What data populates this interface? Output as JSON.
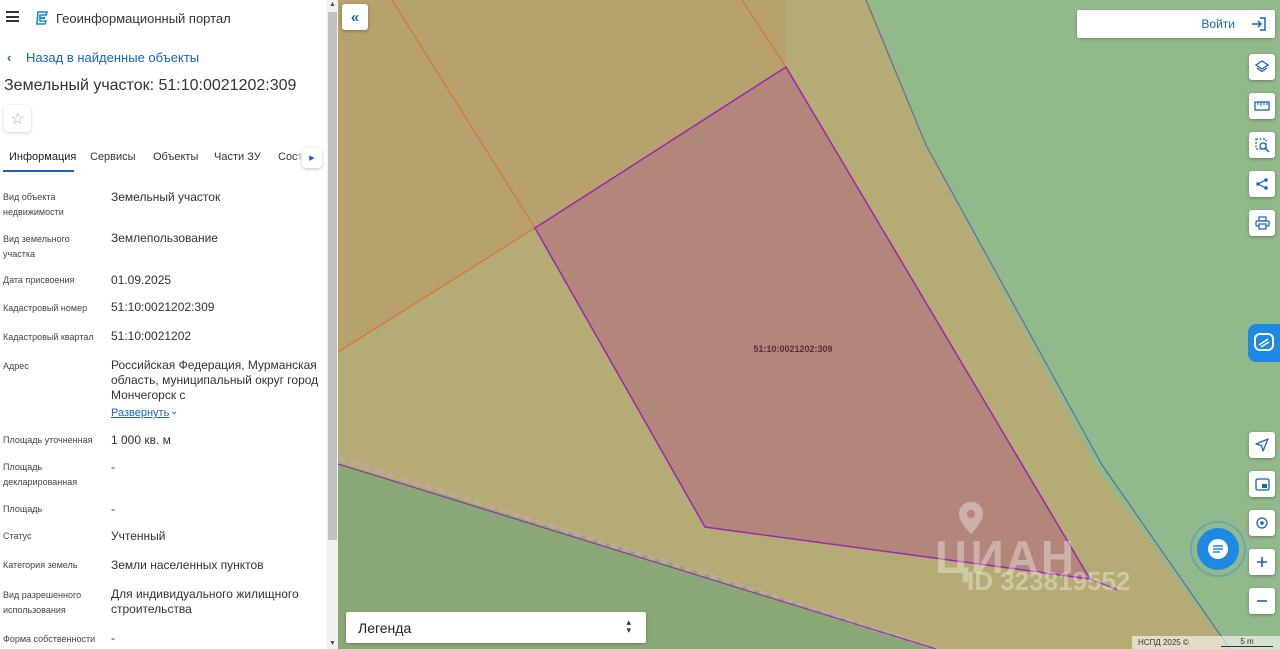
{
  "header": {
    "app_title": "Геоинформационный портал",
    "menu_icon": "hamburger-menu-icon",
    "logo_icon": "portal-logo-icon"
  },
  "back_link": "Назад в найденные объекты",
  "object_title": "Земельный участок: 51:10:0021202:309",
  "tabs": [
    {
      "label": "Информация",
      "active": true
    },
    {
      "label": "Сервисы"
    },
    {
      "label": "Объекты"
    },
    {
      "label": "Части ЗУ"
    },
    {
      "label": "Соста"
    }
  ],
  "properties": [
    {
      "label": "Вид объекта недвижимости",
      "value": "Земельный участок"
    },
    {
      "label": "Вид земельного участка",
      "value": "Землепользование"
    },
    {
      "label": "Дата присвоения",
      "value": "01.09.2025"
    },
    {
      "label": "Кадастровый номер",
      "value": "51:10:0021202:309"
    },
    {
      "label": "Кадастровый квартал",
      "value": "51:10:0021202"
    },
    {
      "label": "Адрес",
      "value": "Российская Федерация, Мурманская область, муниципальный округ город Мончегорск с"
    },
    {
      "label": "Площадь уточненная",
      "value": "1 000 кв. м"
    },
    {
      "label": "Площадь декларированная",
      "value": "-"
    },
    {
      "label": "Площадь",
      "value": "-"
    },
    {
      "label": "Статус",
      "value": "Учтенный"
    },
    {
      "label": "Категория земель",
      "value": "Земли населенных пунктов"
    },
    {
      "label": "Вид разрешенного использования",
      "value": "Для индивидуального жилищного строительства"
    },
    {
      "label": "Форма собственности",
      "value": "-"
    }
  ],
  "expand_link": "Развернуть",
  "map": {
    "parcel_label": "51:10:0021202:309",
    "login_label": "Войти",
    "legend_label": "Легенда",
    "attribution": "НСПД 2025 ©",
    "scale_label": "5 m",
    "watermark_text": "ЦИАН",
    "watermark_id": "ID 323819552",
    "tools": [
      "layers-icon",
      "ruler-icon",
      "area-search-icon",
      "share-icon",
      "print-icon",
      "navigate-icon",
      "minimap-icon",
      "locate-icon",
      "zoom-in-icon",
      "zoom-out-icon"
    ]
  },
  "colors": {
    "accent": "#1565c0",
    "parcel_fill": "#b3867b",
    "parcel_stroke": "#9c27b0",
    "land_green": "#92b98b",
    "land_olive": "#b7ab76",
    "land_orange": "#b9a46f"
  }
}
